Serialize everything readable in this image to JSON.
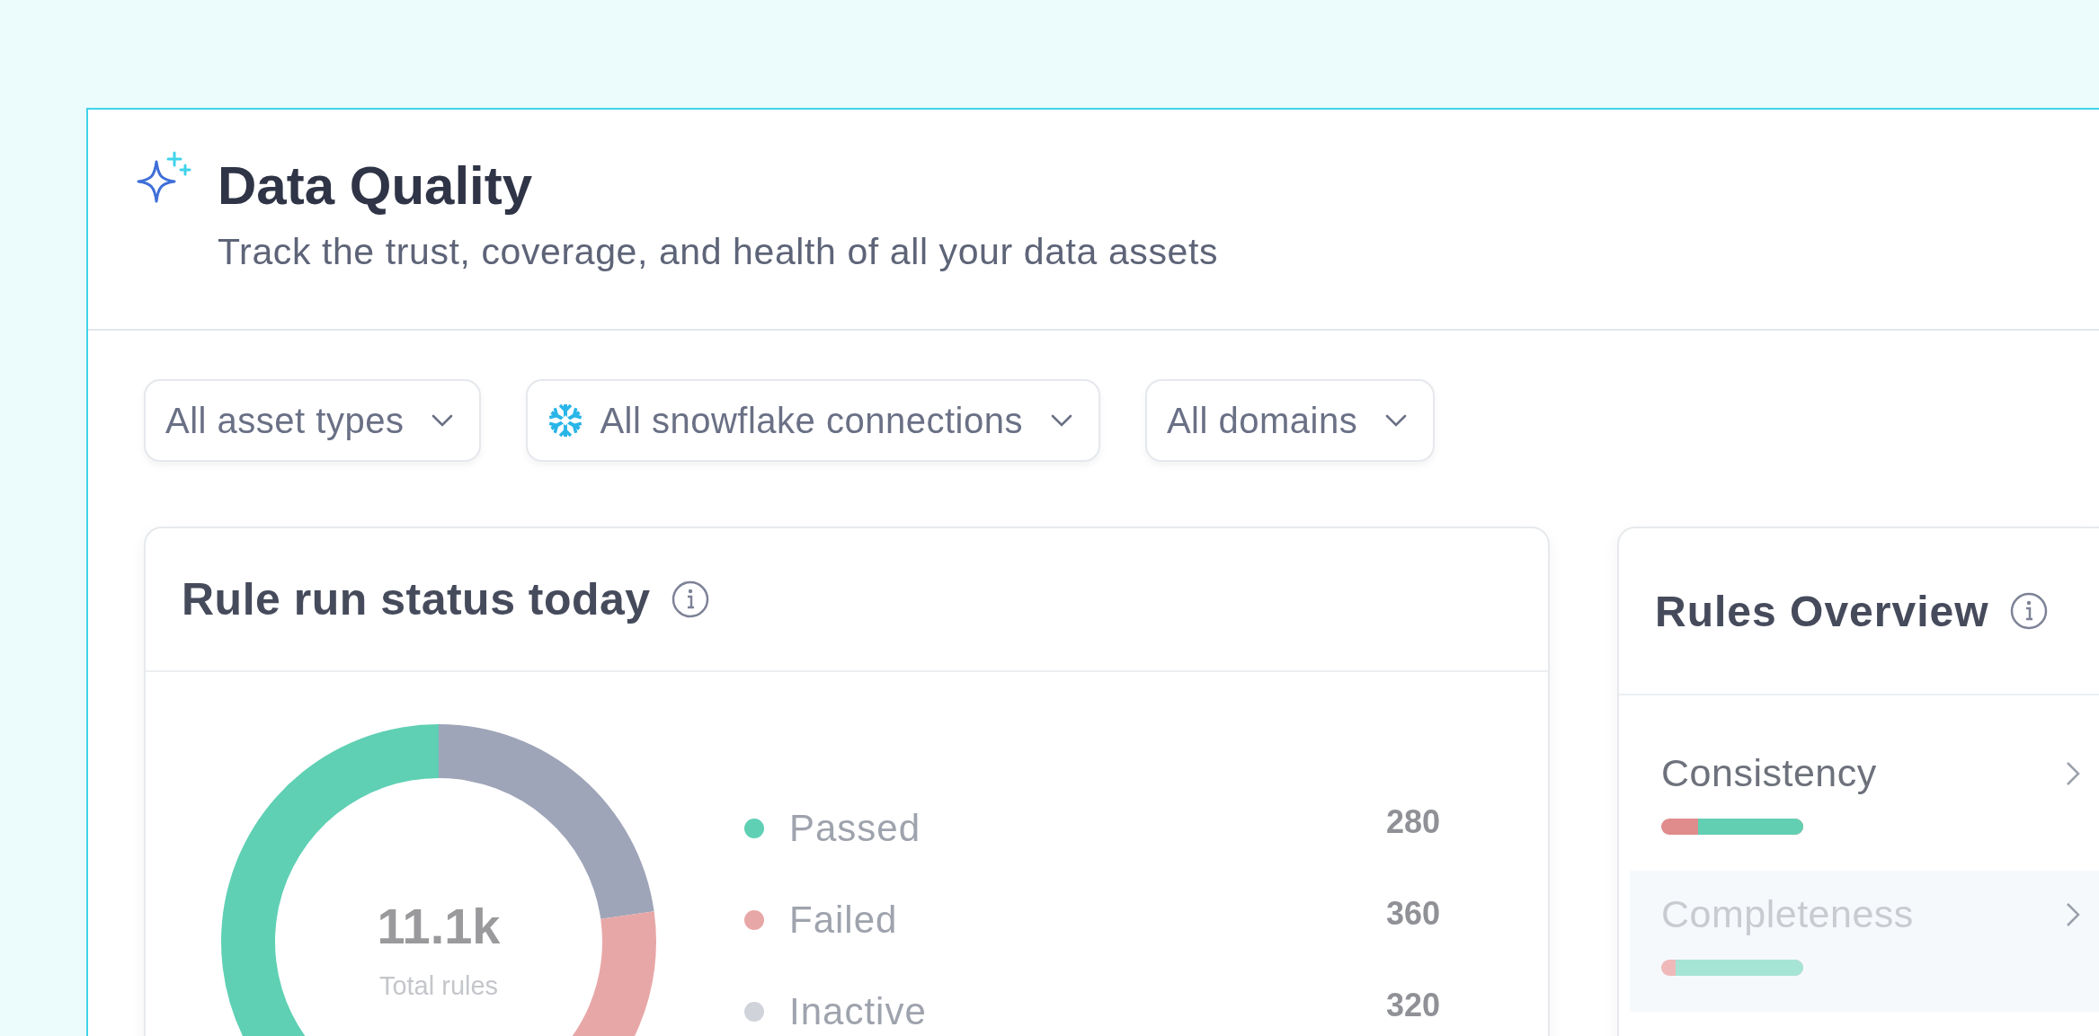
{
  "header": {
    "title": "Data Quality",
    "subtitle": "Track the trust, coverage, and health of all your data assets"
  },
  "filters": [
    {
      "label": "All asset types",
      "kind": "plain"
    },
    {
      "label": "All snowflake connections",
      "kind": "snowflake"
    },
    {
      "label": "All domains",
      "kind": "plain"
    }
  ],
  "rule_run_status": {
    "title": "Rule run status today",
    "total": "11.1k",
    "total_label": "Total rules",
    "legend": [
      {
        "label": "Passed",
        "value": "280",
        "color": "#5fd0b4"
      },
      {
        "label": "Failed",
        "value": "360",
        "color": "#e8a7a7"
      },
      {
        "label": "Inactive",
        "value": "320",
        "color": "#d0d3da"
      }
    ]
  },
  "rules_overview": {
    "title": "Rules Overview",
    "items": [
      {
        "label": "Consistency",
        "selected": false,
        "level": 0.74
      },
      {
        "label": "Completeness",
        "selected": true,
        "level": 0.9
      }
    ]
  }
}
